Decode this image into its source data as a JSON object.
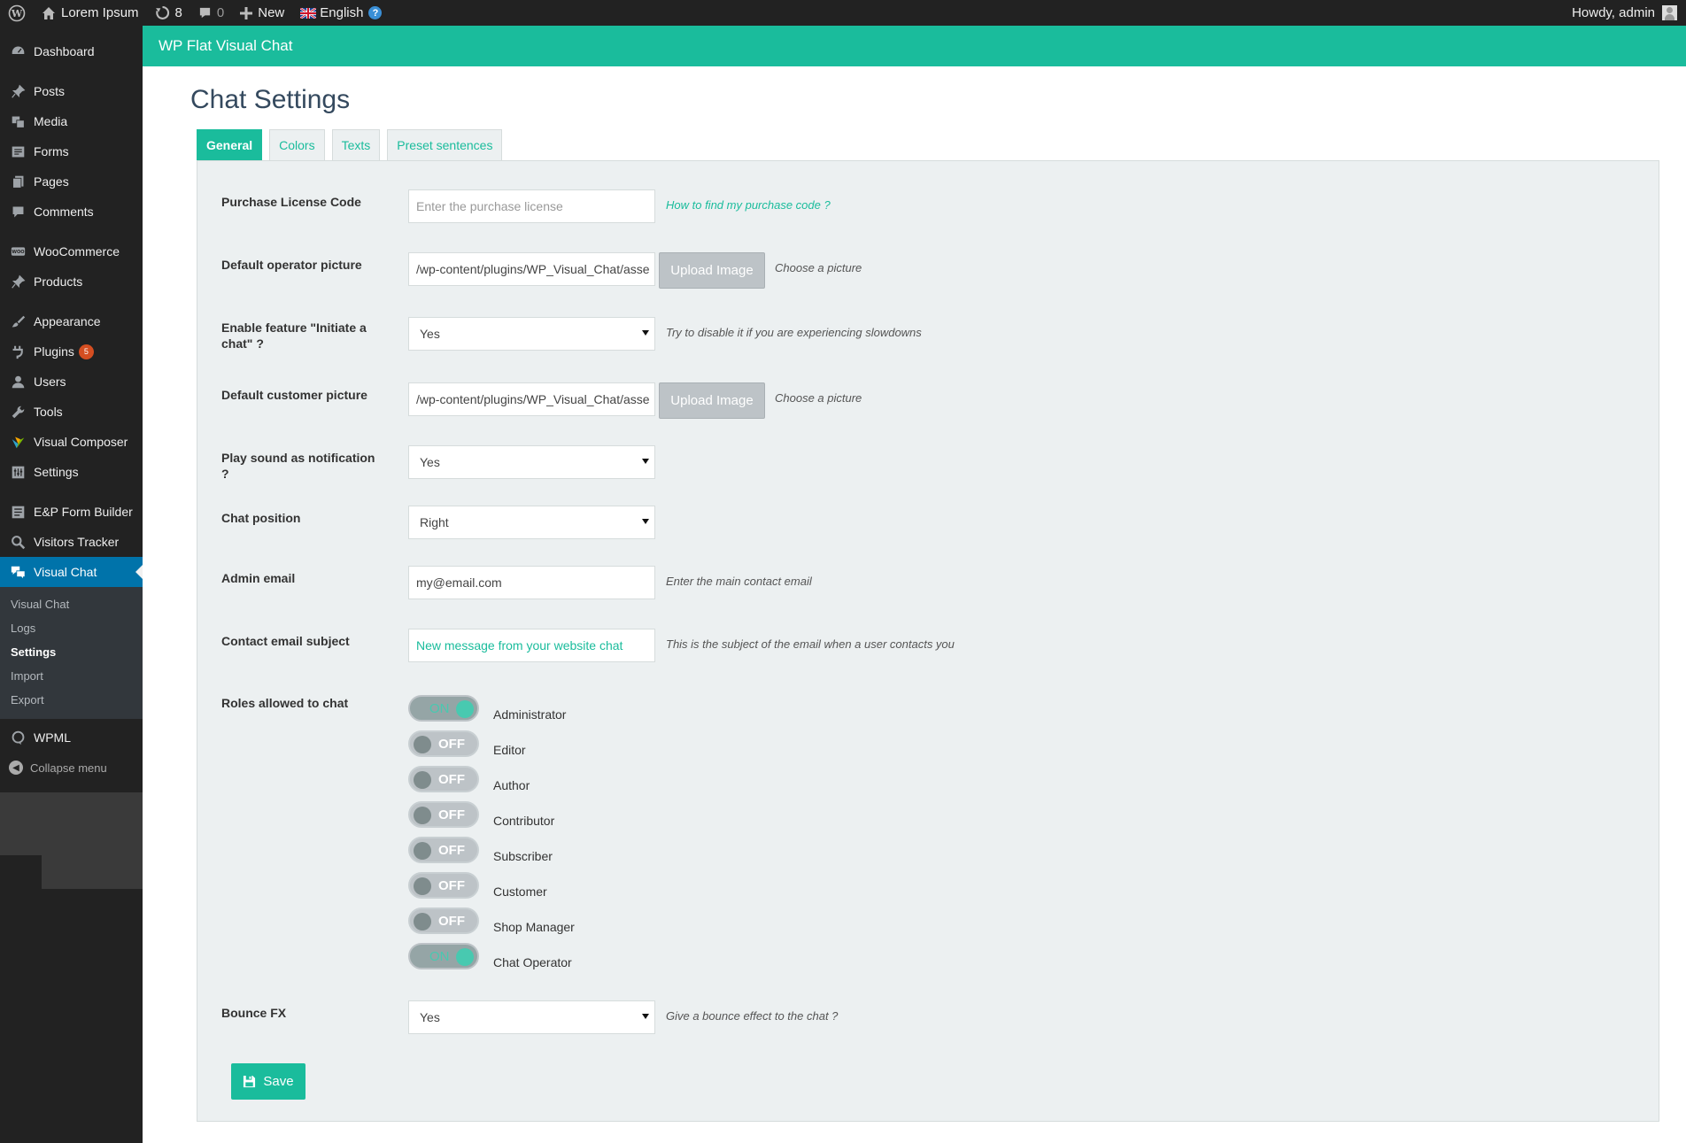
{
  "admin_bar": {
    "site_name": "Lorem Ipsum",
    "updates_count": "8",
    "comments_count": "0",
    "new_label": "New",
    "language": "English",
    "greeting": "Howdy, admin"
  },
  "sidebar": {
    "groups": [
      [
        {
          "label": "Dashboard",
          "icon": "dashboard-icon"
        }
      ],
      [
        {
          "label": "Posts",
          "icon": "pin-icon"
        },
        {
          "label": "Media",
          "icon": "media-icon"
        },
        {
          "label": "Forms",
          "icon": "forms-icon"
        },
        {
          "label": "Pages",
          "icon": "pages-icon"
        },
        {
          "label": "Comments",
          "icon": "comment-icon"
        }
      ],
      [
        {
          "label": "WooCommerce",
          "icon": "woocommerce-icon"
        },
        {
          "label": "Products",
          "icon": "pin-icon"
        }
      ],
      [
        {
          "label": "Appearance",
          "icon": "brush-icon"
        },
        {
          "label": "Plugins",
          "icon": "plug-icon",
          "badge": "5"
        },
        {
          "label": "Users",
          "icon": "user-icon"
        },
        {
          "label": "Tools",
          "icon": "wrench-icon"
        },
        {
          "label": "Visual Composer",
          "icon": "visual-composer-icon"
        },
        {
          "label": "Settings",
          "icon": "settings-icon"
        }
      ],
      [
        {
          "label": "E&P Form Builder",
          "icon": "form-builder-icon"
        },
        {
          "label": "Visitors Tracker",
          "icon": "search-icon"
        },
        {
          "label": "Visual Chat",
          "icon": "chat-icon",
          "current": true
        }
      ]
    ],
    "submenu": [
      {
        "label": "Visual Chat"
      },
      {
        "label": "Logs"
      },
      {
        "label": "Settings",
        "active": true
      },
      {
        "label": "Import"
      },
      {
        "label": "Export"
      }
    ],
    "after": [
      {
        "label": "WPML",
        "icon": "wpml-icon"
      }
    ],
    "collapse_label": "Collapse menu"
  },
  "header": {
    "title": "WP Flat Visual Chat"
  },
  "page": {
    "title": "Chat Settings"
  },
  "tabs": [
    {
      "label": "General",
      "active": true
    },
    {
      "label": "Colors"
    },
    {
      "label": "Texts"
    },
    {
      "label": "Preset sentences"
    }
  ],
  "form": {
    "license": {
      "label": "Purchase License Code",
      "placeholder": "Enter the purchase license",
      "hint": "How to find my purchase code ?"
    },
    "operator_picture": {
      "label": "Default operator picture",
      "value": "/wp-content/plugins/WP_Visual_Chat/asse",
      "button": "Upload Image",
      "hint": "Choose a picture"
    },
    "initiate_chat": {
      "label": "Enable feature \"Initiate a chat\" ?",
      "value": "Yes",
      "hint": "Try to disable it if you are experiencing slowdowns"
    },
    "customer_picture": {
      "label": "Default customer picture",
      "value": "/wp-content/plugins/WP_Visual_Chat/asse",
      "button": "Upload Image",
      "hint": "Choose a picture"
    },
    "play_sound": {
      "label": "Play sound as notification ?",
      "value": "Yes"
    },
    "chat_position": {
      "label": "Chat position",
      "value": "Right"
    },
    "admin_email": {
      "label": "Admin email",
      "value": "my@email.com",
      "hint": "Enter the main contact email"
    },
    "email_subject": {
      "label": "Contact email subject",
      "value": "New message from your website chat",
      "hint": "This is the subject of the email when a user contacts you"
    },
    "roles": {
      "label": "Roles allowed to chat",
      "on_label": "ON",
      "off_label": "OFF",
      "items": [
        {
          "name": "Administrator",
          "on": true
        },
        {
          "name": "Editor",
          "on": false
        },
        {
          "name": "Author",
          "on": false
        },
        {
          "name": "Contributor",
          "on": false
        },
        {
          "name": "Subscriber",
          "on": false
        },
        {
          "name": "Customer",
          "on": false
        },
        {
          "name": "Shop Manager",
          "on": false
        },
        {
          "name": "Chat Operator",
          "on": true
        }
      ]
    },
    "bounce": {
      "label": "Bounce FX",
      "value": "Yes",
      "hint": "Give a bounce effect to the chat ?"
    },
    "save_label": "Save"
  },
  "colors": {
    "accent": "#1abc9c",
    "admin_bar": "#222222",
    "current_menu": "#0073aa",
    "panel": "#ecf0f1"
  }
}
